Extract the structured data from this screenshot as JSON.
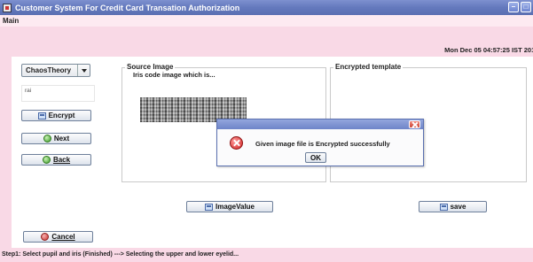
{
  "window": {
    "title": "Customer System For Credit Card Transation Authorization",
    "controls": [
      "minimize-icon",
      "maximize-icon"
    ]
  },
  "menubar": {
    "main_label": "Main"
  },
  "header": {
    "datetime": "Mon Dec 05 04:57:25 IST 2011"
  },
  "sidebar": {
    "algorithm_select": {
      "value": "ChaosTheory"
    },
    "text_field": {
      "value": "rai"
    },
    "encrypt_label": "Encrypt",
    "next_label": "Next",
    "back_label": "Back",
    "cancel_label": "Cancel"
  },
  "source_panel": {
    "title": "Source Image",
    "subtitle": "Iris code image which is..."
  },
  "template_panel": {
    "title": "Encrypted template"
  },
  "buttons": {
    "image_value_label": "ImageValue",
    "save_label": "save"
  },
  "dialog": {
    "message": "Given image file is Encrypted successfully",
    "ok_label": "OK",
    "icon": "error-icon"
  },
  "status": {
    "text": "Step1: Select pupil and iris (Finished) ---> Selecting the upper and lower eyelid..."
  },
  "colors": {
    "titlebar": "#6479bd",
    "pink_band": "#f9d9e6",
    "menubar": "#fdeaf1",
    "button_border": "#6d7f9a"
  }
}
